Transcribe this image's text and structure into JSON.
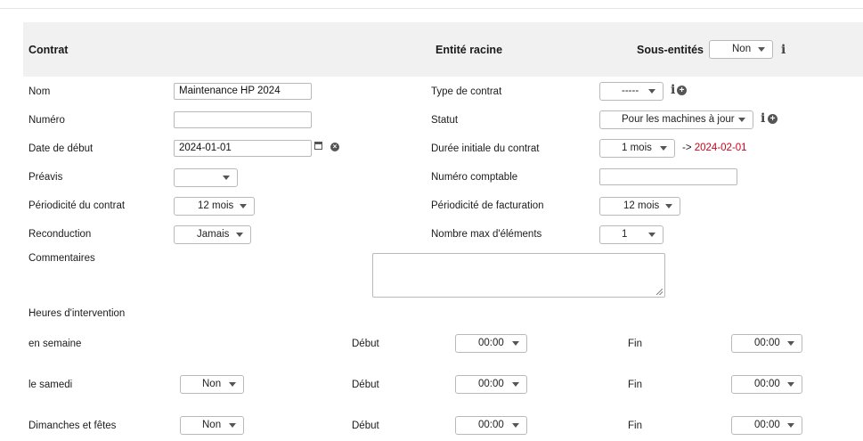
{
  "header": {
    "contract_title": "Contrat",
    "root_entity": "Entité racine",
    "sub_entities_label": "Sous-entités",
    "sub_entities_value": "Non"
  },
  "fields": {
    "name": {
      "label": "Nom",
      "value": "Maintenance HP 2024"
    },
    "number": {
      "label": "Numéro",
      "value": ""
    },
    "start_date": {
      "label": "Date de début",
      "value": "2024-01-01"
    },
    "notice": {
      "label": "Préavis",
      "value": ""
    },
    "contract_period": {
      "label": "Périodicité du contrat",
      "value": "12 mois"
    },
    "renewal": {
      "label": "Reconduction",
      "value": "Jamais"
    },
    "comments": {
      "label": "Commentaires",
      "value": ""
    },
    "contract_type": {
      "label": "Type de contrat",
      "value": "-----"
    },
    "status": {
      "label": "Statut",
      "value": "Pour les machines à jour"
    },
    "initial_duration": {
      "label": "Durée initiale du contrat",
      "value": "1 mois",
      "end_date_prefix": "->",
      "end_date": "2024-02-01"
    },
    "accounting_number": {
      "label": "Numéro comptable",
      "value": ""
    },
    "billing_period": {
      "label": "Périodicité de facturation",
      "value": "12 mois"
    },
    "max_items": {
      "label": "Nombre max d'éléments",
      "value": "1"
    }
  },
  "hours": {
    "title": "Heures d'intervention",
    "start_label": "Début",
    "end_label": "Fin",
    "rows": [
      {
        "label": "en semaine",
        "enabled": "",
        "start": "00:00",
        "end": "00:00"
      },
      {
        "label": "le samedi",
        "enabled": "Non",
        "start": "00:00",
        "end": "00:00"
      },
      {
        "label": "Dimanches et fêtes",
        "enabled": "Non",
        "start": "00:00",
        "end": "00:00"
      }
    ]
  },
  "colors": {
    "header_bg": "#f1f1f1",
    "end_date_red": "#d0021b"
  }
}
